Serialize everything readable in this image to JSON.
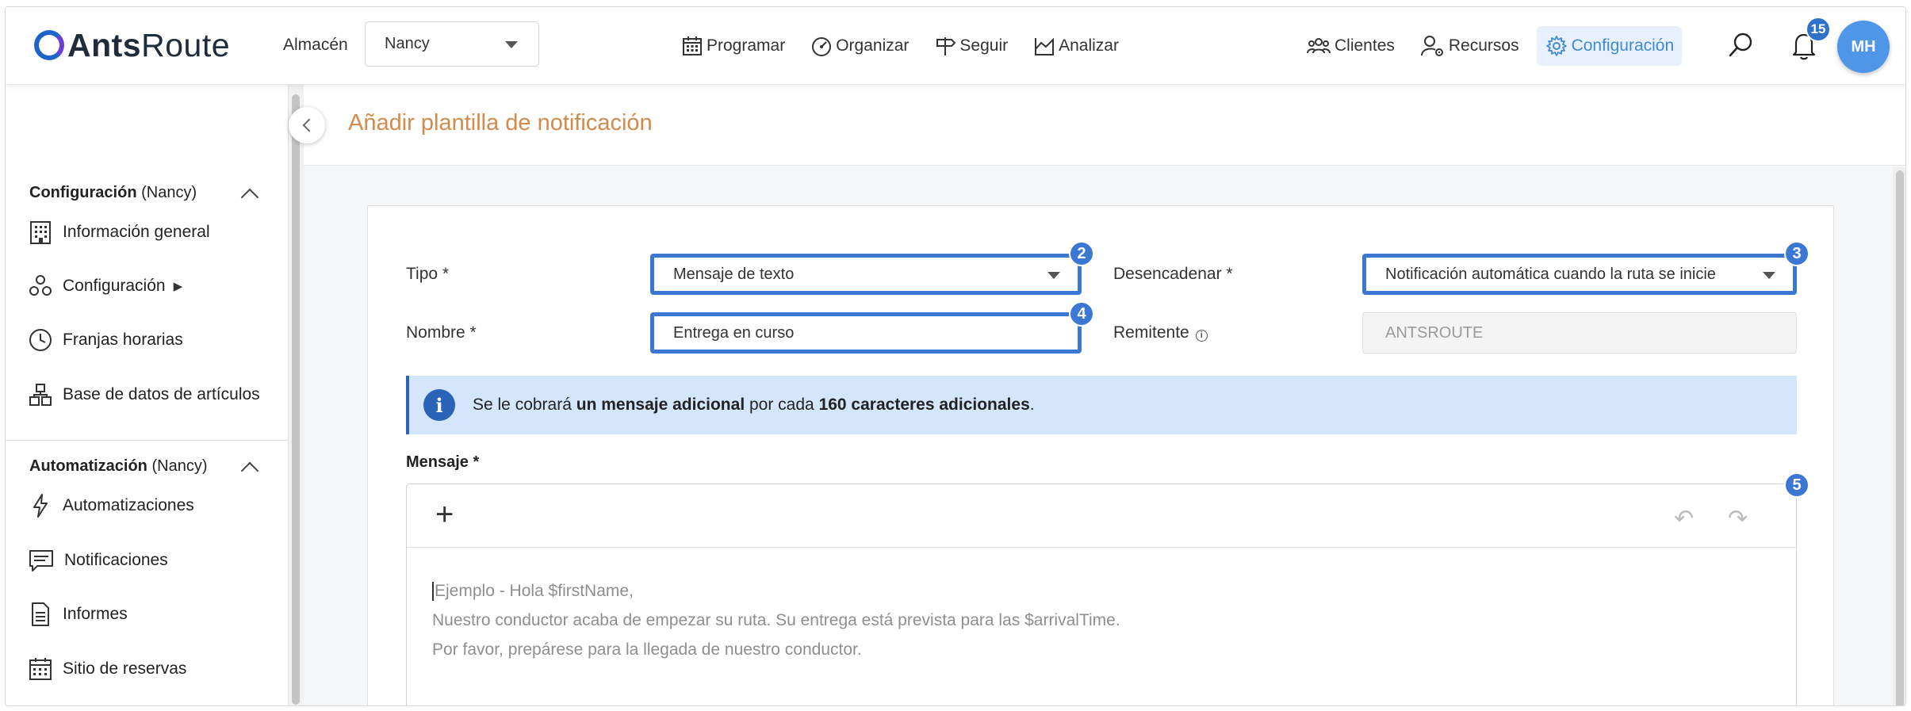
{
  "app": {
    "logo_bold": "Ants",
    "logo_light": "Route"
  },
  "header": {
    "warehouse_label": "Almacén",
    "warehouse_value": "Nancy",
    "nav_center": [
      "Programar",
      "Organizar",
      "Seguir",
      "Analizar"
    ],
    "nav_right": [
      "Clientes",
      "Recursos",
      "Configuración"
    ],
    "notification_count": "15",
    "avatar_initials": "MH"
  },
  "sidebar": {
    "section1": {
      "title": "Configuración",
      "context": "(Nancy)"
    },
    "items1": [
      {
        "label": "Información general",
        "icon": "building-icon"
      },
      {
        "label": "Configuración",
        "icon": "boxes-icon",
        "submenu_marker": "▶"
      },
      {
        "label": "Franjas horarias",
        "icon": "clock-icon"
      },
      {
        "label": "Base de datos de artículos",
        "icon": "inventory-icon"
      }
    ],
    "section2": {
      "title": "Automatización",
      "context": "(Nancy)"
    },
    "items2": [
      {
        "label": "Automatizaciones",
        "icon": "bolt-icon"
      },
      {
        "label": "Notificaciones",
        "icon": "message-icon"
      },
      {
        "label": "Informes",
        "icon": "document-icon"
      },
      {
        "label": "Sitio de reservas",
        "icon": "calendar-icon"
      }
    ]
  },
  "page": {
    "title": "Añadir plantilla de notificación"
  },
  "form": {
    "tipo_label": "Tipo *",
    "tipo_value": "Mensaje de texto",
    "tipo_badge": "2",
    "trigger_label": "Desencadenar *",
    "trigger_value": "Notificación automática cuando la ruta se inicie",
    "trigger_badge": "3",
    "nombre_label": "Nombre *",
    "nombre_value": "Entrega en curso",
    "nombre_badge": "4",
    "remitente_label": "Remitente",
    "remitente_value": "ANTSROUTE",
    "banner": {
      "icon": "i",
      "t1": "Se le cobrará ",
      "b1": "un mensaje adicional",
      "t2": " por cada ",
      "b2": "160 caracteres adicionales",
      "t3": "."
    },
    "message_label": "Mensaje *",
    "editor_badge": "5",
    "placeholder_lines": [
      "Ejemplo - Hola $firstName,",
      "Nuestro conductor acaba de empezar su ruta. Su entrega está prevista para las $arrivalTime.",
      "Por favor, prepárese para la llegada de nuestro conductor."
    ]
  },
  "colors": {
    "primary": "#3a78d4",
    "title_orange": "#d38a4a",
    "banner_bg": "#d4e6fb",
    "active_nav": "#3f8ad6"
  }
}
